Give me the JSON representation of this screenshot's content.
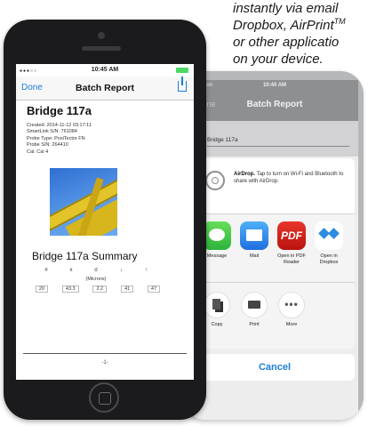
{
  "caption": {
    "line1": "instantly via email",
    "line2": "Dropbox, AirPrint",
    "line2_tm": "TM",
    "line3": "or other applicatio",
    "line4": "on your device."
  },
  "phone_front": {
    "status_time": "10:45 AM",
    "nav_done": "Done",
    "nav_title": "Batch Report",
    "doc_title": "Bridge 117a",
    "meta": [
      "Created: 2014-11-12 03:17:11",
      "SmartLink S/N: 761084",
      "Probe Type: PosiTector FN",
      "Probe S/N: 264410",
      "Cal: Cal 4"
    ],
    "summary_title": "Bridge 117a Summary",
    "summary_labels": [
      "#",
      "x",
      "σ",
      "↓",
      "↑"
    ],
    "summary_units": "(Microns)",
    "summary_values": [
      "20",
      "43.3",
      "2.2",
      "41",
      "47"
    ],
    "page_number": "-1-"
  },
  "phone_back": {
    "carrier": "Verizon",
    "status_time": "10:40 AM",
    "nav_done": "Done",
    "nav_title": "Batch Report",
    "doc_title": "Bridge 117a",
    "airdrop_bold": "AirDrop.",
    "airdrop_text": "Tap to turn on Wi-Fi and Bluetooth to share with AirDrop.",
    "apps": [
      {
        "label": "Message",
        "icon": "message-icon"
      },
      {
        "label": "Mail",
        "icon": "mail-icon"
      },
      {
        "label": "Open in PDF Reader",
        "icon": "pdf-icon",
        "icon_text": "PDF"
      },
      {
        "label": "Open in Dropbox",
        "icon": "dropbox-icon"
      }
    ],
    "actions": [
      {
        "label": "Copy",
        "icon": "copy-icon"
      },
      {
        "label": "Print",
        "icon": "print-icon"
      },
      {
        "label": "More",
        "icon": "more-icon",
        "icon_text": "•••"
      }
    ],
    "cancel_label": "Cancel"
  },
  "colors": {
    "ios_blue": "#1a7ddb",
    "phone_body": "#1b1b1d",
    "pdf_red": "#d8241c"
  }
}
